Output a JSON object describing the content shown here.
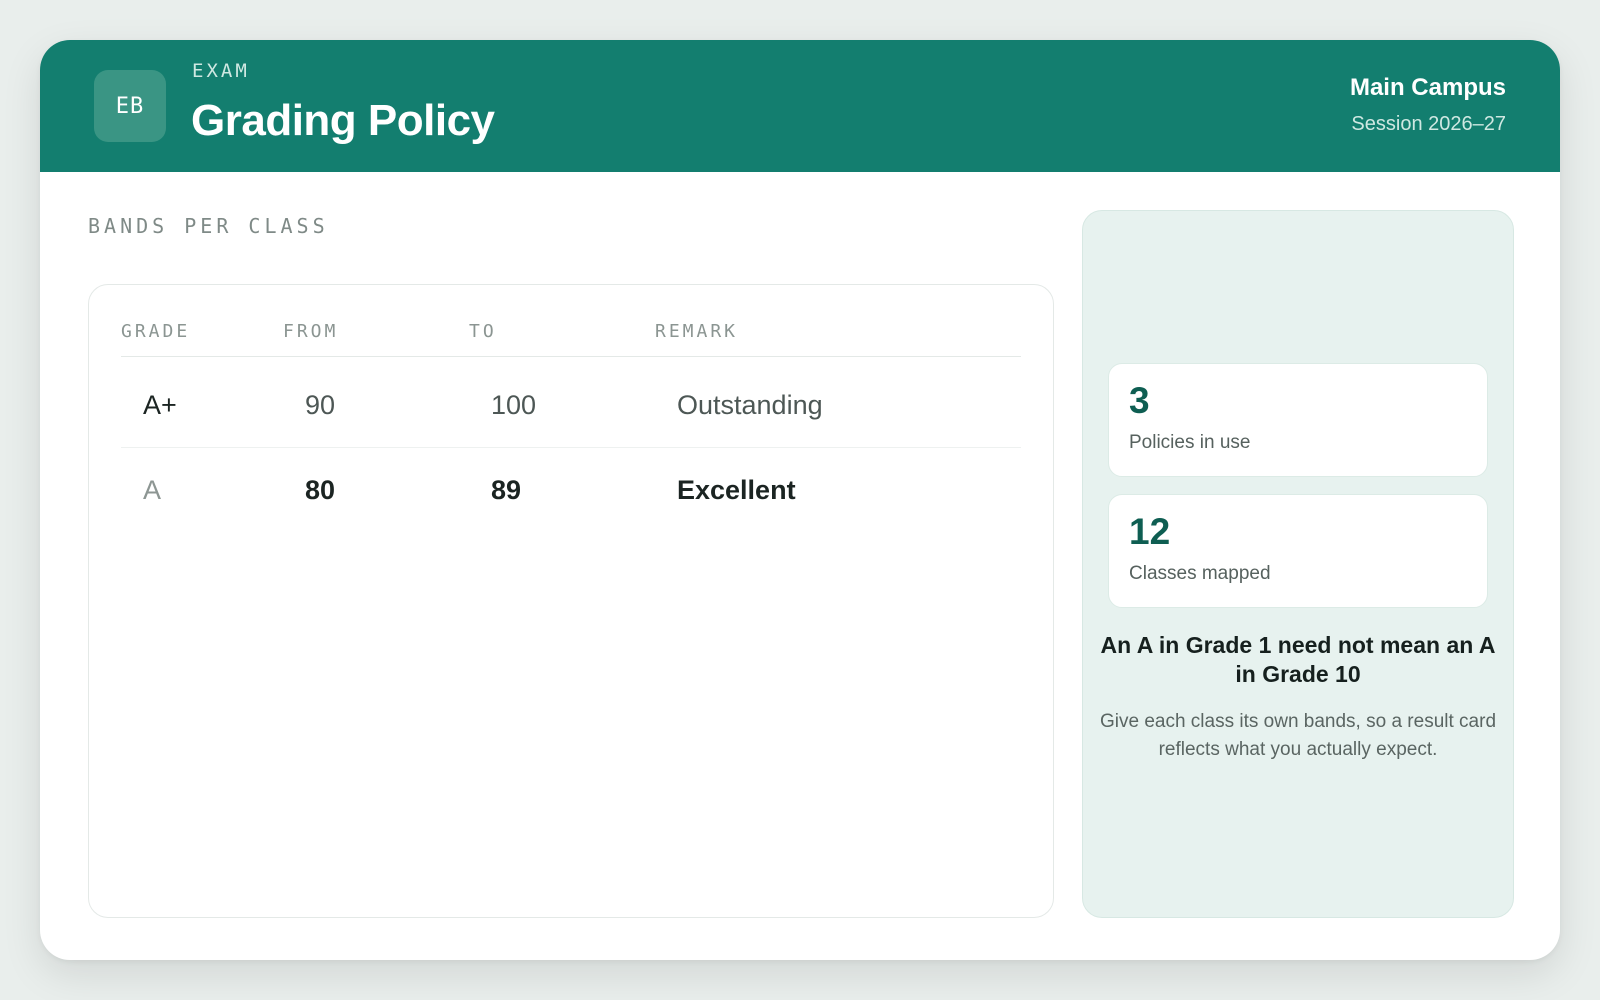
{
  "header": {
    "logo_initials": "EB",
    "eyebrow": "EXAM",
    "title": "Grading Policy",
    "campus": "Main Campus",
    "session": "Session 2026–27"
  },
  "section": {
    "label": "BANDS PER CLASS"
  },
  "table": {
    "columns": [
      "GRADE",
      "FROM",
      "TO",
      "REMARK"
    ],
    "rows": [
      {
        "grade": "A+",
        "from": "90",
        "to": "100",
        "remark": "Outstanding"
      },
      {
        "grade": "A",
        "from": "80",
        "to": "89",
        "remark": "Excellent"
      }
    ]
  },
  "sidebar": {
    "stats": [
      {
        "value": "3",
        "label": "Policies in use"
      },
      {
        "value": "12",
        "label": "Classes mapped"
      }
    ],
    "note_title": "An A in Grade 1 need not mean an A in Grade 10",
    "note_body": "Give each class its own bands, so a result card reflects what you actually expect."
  },
  "colors": {
    "brand": "#137e6f",
    "accent_text": "#0e5e52",
    "side_panel": "#e7f2ef"
  }
}
